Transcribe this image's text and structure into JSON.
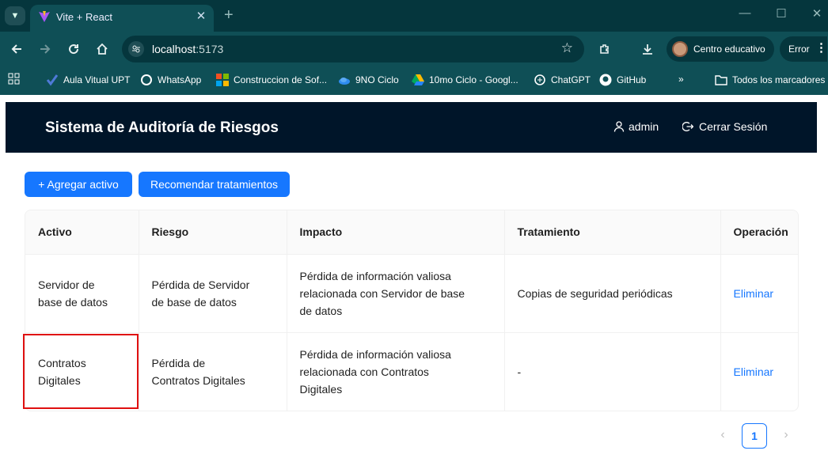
{
  "browser": {
    "tab_title": "Vite + React",
    "url_host": "localhost",
    "url_port": ":5173",
    "profile_name": "Centro educativo",
    "error_label": "Error"
  },
  "bookmarks": [
    {
      "label": "Aula Vitual UPT",
      "icon": "checkmark-icon"
    },
    {
      "label": "WhatsApp",
      "icon": "whatsapp-icon"
    },
    {
      "label": "Construccion de Sof...",
      "icon": "microsoft-icon"
    },
    {
      "label": "9NO Ciclo",
      "icon": "onedrive-icon"
    },
    {
      "label": "10mo Ciclo - Googl...",
      "icon": "google-drive-icon"
    },
    {
      "label": "ChatGPT",
      "icon": "chatgpt-icon"
    },
    {
      "label": "GitHub",
      "icon": "github-icon"
    },
    {
      "label": "Todos los marcadores",
      "icon": "folder-icon"
    }
  ],
  "app": {
    "title": "Sistema de Auditoría de Riesgos",
    "user_label": "admin",
    "logout_label": "Cerrar Sesión",
    "add_button": "+ Agregar activo",
    "recommend_button": "Recomendar tratamientos"
  },
  "table": {
    "columns": [
      "Activo",
      "Riesgo",
      "Impacto",
      "Tratamiento",
      "Operación"
    ],
    "rows": [
      {
        "activo": "Servidor de base de datos",
        "riesgo": "Pérdida de Servidor de base de datos",
        "impacto": "Pérdida de información valiosa relacionada con Servidor de base de datos",
        "tratamiento": "Copias de seguridad periódicas",
        "operacion": "Eliminar"
      },
      {
        "activo": "Contratos Digitales",
        "riesgo": "Pérdida de Contratos Digitales",
        "impacto": "Pérdida de información valiosa relacionada con Contratos Digitales",
        "tratamiento": "-",
        "operacion": "Eliminar"
      }
    ]
  },
  "pagination": {
    "current_page": "1"
  },
  "colors": {
    "primary": "#1677ff",
    "header_bg": "#001529",
    "chrome_bg": "#0f4f56",
    "highlight": "#e01010"
  }
}
